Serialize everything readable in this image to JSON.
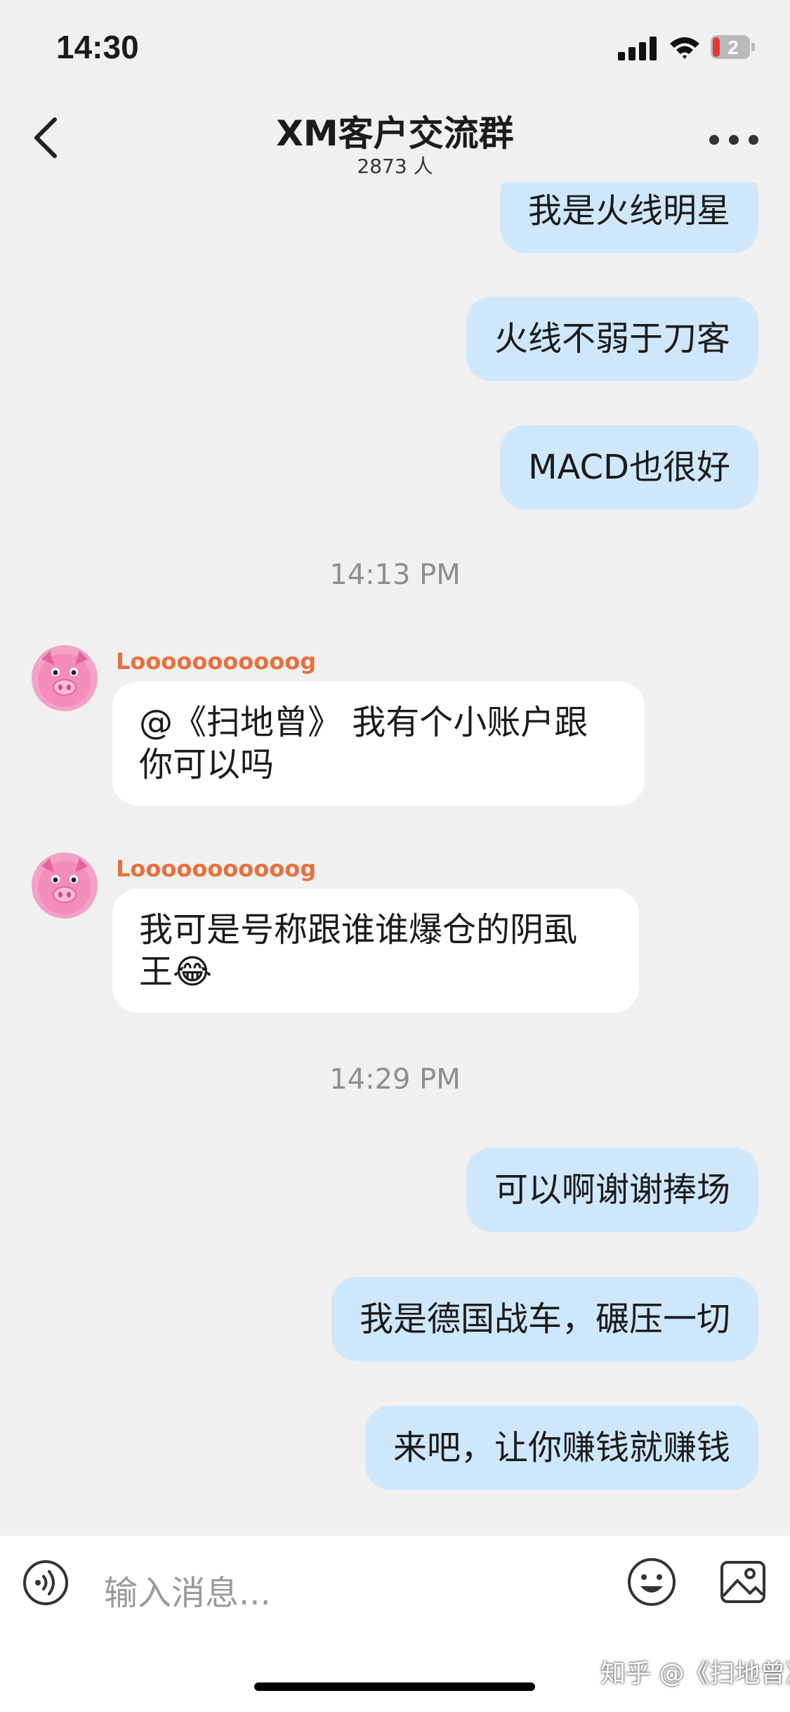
{
  "status_bar": {
    "time": "14:30",
    "battery": "2"
  },
  "header": {
    "back_icon": "chevron-left-icon",
    "title": "XM客户交流群",
    "members": "2873 人",
    "more_icon": "more-dots-icon"
  },
  "messages": {
    "m1": "我是火线明星",
    "m2": "火线不弱于刀客",
    "m3": "MACD也很好",
    "ts1": "14:13 PM",
    "m4_sender": "Looooooooooog",
    "m4_line1": "@《扫地曾》 我有个小账户跟",
    "m4_line2": "你可以吗",
    "m5_sender": "Looooooooooog",
    "m5_line1": "我可是号称跟谁谁爆仓的阴虱",
    "m5_line2": "王",
    "m5_emoji": "😂",
    "ts2": "14:29 PM",
    "m6": "可以啊谢谢捧场",
    "m7": "我是德国战车，碾压一切",
    "m8": "来吧，让你赚钱就赚钱"
  },
  "input": {
    "placeholder": "输入消息...",
    "voice_icon": "voice-icon",
    "emoji_icon": "emoji-icon",
    "image_icon": "image-icon"
  },
  "watermark": "知乎 @《扫地曾》",
  "colors": {
    "mine_bubble": "#cfe7fb",
    "sender_name": "#e7703c",
    "background": "#f0f0f0"
  }
}
